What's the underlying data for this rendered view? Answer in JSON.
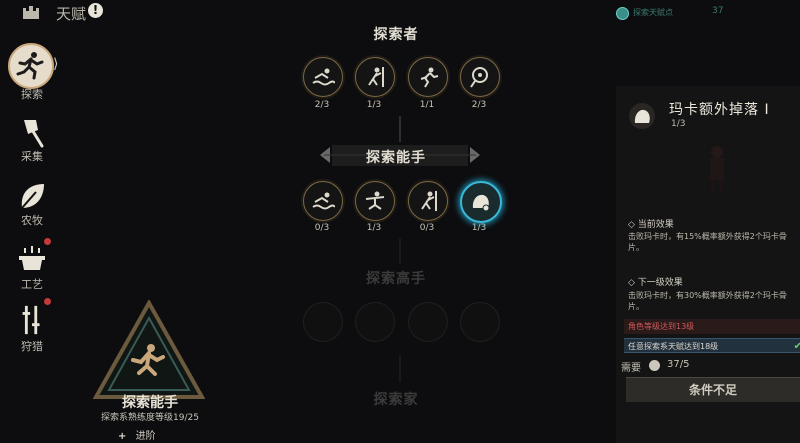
{
  "header": {
    "title": "天赋",
    "alert": "!",
    "points_label": "探索天赋点",
    "points_value": "37"
  },
  "sidebar": {
    "items": [
      {
        "label": "探索",
        "icon": "running-man-icon",
        "active": true
      },
      {
        "label": "采集",
        "icon": "axe-icon",
        "active": false
      },
      {
        "label": "农牧",
        "icon": "leaf-icon",
        "active": false
      },
      {
        "label": "工艺",
        "icon": "cooking-pot-icon",
        "active": false,
        "notify": true
      },
      {
        "label": "狩猎",
        "icon": "hunting-tools-icon",
        "active": false,
        "notify": true
      }
    ]
  },
  "tree": {
    "tier1_title": "探索者",
    "tier1_nodes": [
      {
        "count": "2/3",
        "icon": "swimming-icon"
      },
      {
        "count": "1/3",
        "icon": "climbing-icon"
      },
      {
        "count": "1/1",
        "icon": "sprinting-icon"
      },
      {
        "count": "2/3",
        "icon": "compass-icon"
      }
    ],
    "tier2_title": "探索能手",
    "tier2_nodes": [
      {
        "count": "0/3",
        "icon": "swimming-icon"
      },
      {
        "count": "1/3",
        "icon": "gliding-icon"
      },
      {
        "count": "0/3",
        "icon": "climbing-icon"
      },
      {
        "count": "1/3",
        "icon": "maka-icon"
      }
    ],
    "tier3_title": "探索高手",
    "tier4_title": "探索家"
  },
  "badge": {
    "title": "探索能手",
    "proficiency": "探索系熟练度等级19/25",
    "advance_label": "进阶",
    "advance_icon": "plus-icon"
  },
  "detail": {
    "name": "玛卡额外掉落 I",
    "level": "1/3",
    "current_heading": "◇ 当前效果",
    "current_desc": "击败玛卡时，有15%概率额外获得2个玛卡骨片。",
    "next_heading": "◇ 下一级效果",
    "next_desc": "击败玛卡时，有30%概率额外获得2个玛卡骨片。",
    "req_fail": "角色等级达到13级",
    "req_ok": "任意探索系天赋达到18级",
    "cost_label": "需要",
    "cost_value": "37/5",
    "button": "条件不足"
  },
  "colors": {
    "accent_gold": "#7c6845",
    "selected_cyan": "#3ab8d8",
    "fail_red": "#d05a5a",
    "ok_green": "#6bd06b"
  }
}
